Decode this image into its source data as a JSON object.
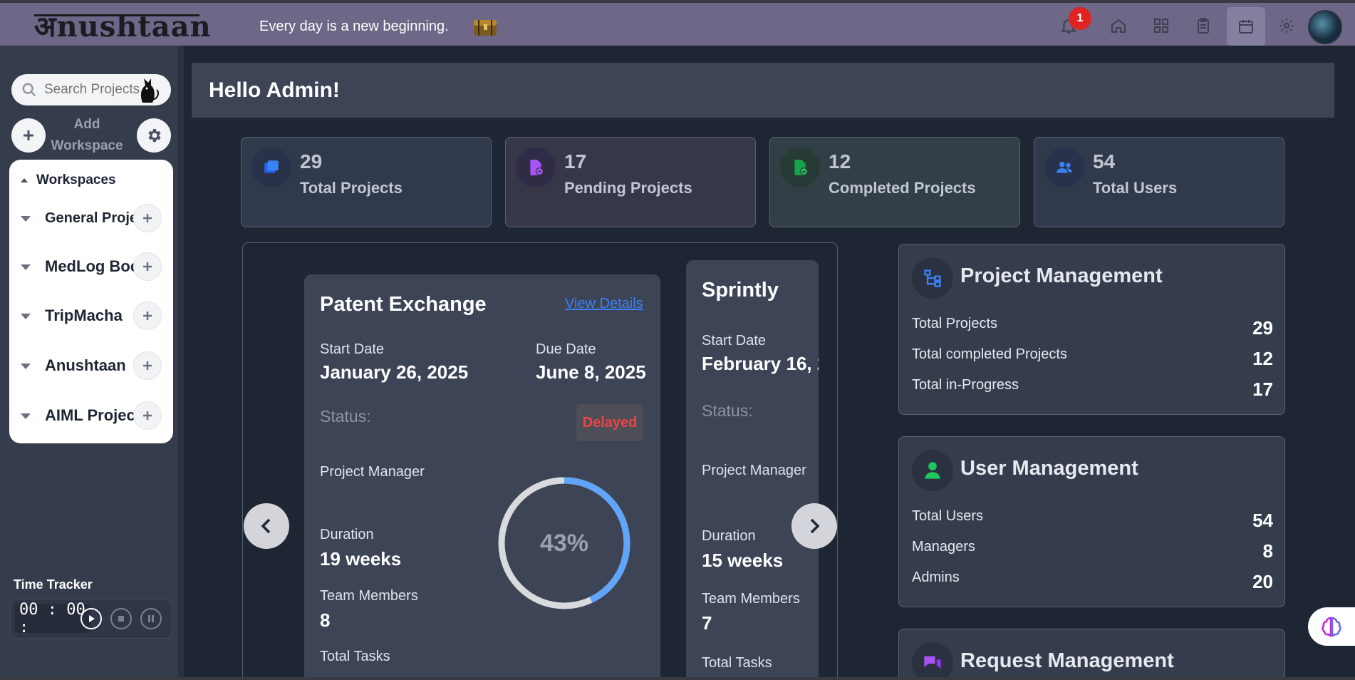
{
  "topbar": {
    "logo": "अnushtaan",
    "tagline": "Every day is a new beginning.",
    "notification_count": "1",
    "icons": [
      "bell-icon",
      "home-icon",
      "grid-icon",
      "clipboard-icon",
      "calendar-icon",
      "gear-icon"
    ],
    "active_icon": "calendar-icon"
  },
  "sidebar": {
    "search_placeholder": "Search Projects",
    "add_workspace_label": "Add Workspace",
    "workspaces_heading": "Workspaces",
    "workspaces": [
      {
        "name": "General Projects"
      },
      {
        "name": "MedLog Book"
      },
      {
        "name": "TripMacha"
      },
      {
        "name": "Anushtaan"
      },
      {
        "name": "AIML Projects"
      }
    ],
    "time_tracker": {
      "label": "Time Tracker",
      "time": "00 : 00 :"
    }
  },
  "main": {
    "greeting": "Hello Admin!",
    "stats": [
      {
        "value": "29",
        "label": "Total Projects",
        "color": "#3b82f6"
      },
      {
        "value": "17",
        "label": "Pending Projects",
        "color": "#a855f7"
      },
      {
        "value": "12",
        "label": "Completed Projects",
        "color": "#22c55e"
      },
      {
        "value": "54",
        "label": "Total Users",
        "color": "#3b82f6"
      }
    ],
    "projects": [
      {
        "title": "Patent Exchange",
        "view_details": "View Details",
        "start_label": "Start Date",
        "start_date": "January 26, 2025",
        "due_label": "Due Date",
        "due_date": "June 8, 2025",
        "status_label": "Status:",
        "status": "Delayed",
        "manager_label": "Project Manager",
        "duration_label": "Duration",
        "duration": "19 weeks",
        "team_label": "Team Members",
        "team": "8",
        "tasks_label": "Total Tasks",
        "progress": 43,
        "progress_text": "43%"
      },
      {
        "title": "Sprintly",
        "start_label": "Start Date",
        "start_date": "February 16, 2",
        "status_label": "Status:",
        "manager_label": "Project Manager",
        "duration_label": "Duration",
        "duration": "15 weeks",
        "team_label": "Team Members",
        "team": "7",
        "tasks_label": "Total Tasks"
      }
    ],
    "project_management": {
      "title": "Project Management",
      "rows": [
        {
          "label": "Total Projects",
          "value": "29"
        },
        {
          "label": "Total completed Projects",
          "value": "12"
        },
        {
          "label": "Total in-Progress",
          "value": "17"
        }
      ]
    },
    "user_management": {
      "title": "User Management",
      "rows": [
        {
          "label": "Total Users",
          "value": "54"
        },
        {
          "label": "Managers",
          "value": "8"
        },
        {
          "label": "Admins",
          "value": "20"
        }
      ]
    },
    "request_management": {
      "title": "Request Management"
    }
  },
  "colors": {
    "accent_blue": "#60a5fa",
    "danger": "#ef4444",
    "topbar": "#6e6788"
  }
}
